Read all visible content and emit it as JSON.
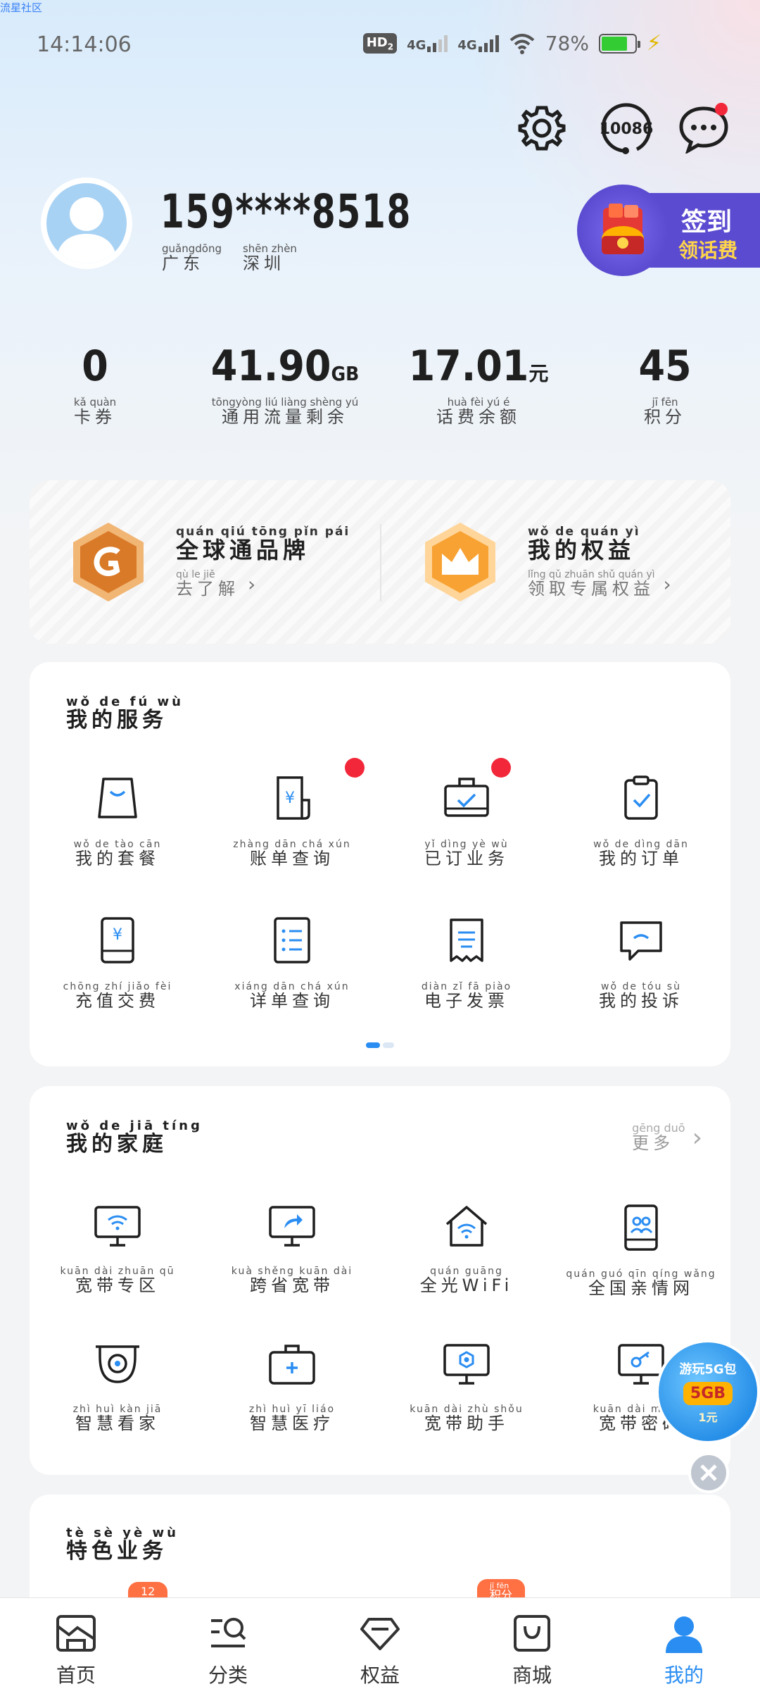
{
  "watermark": "流星社区",
  "status_bar": {
    "time": "14:14:06",
    "hd_label": "HD",
    "hd_sub": "2",
    "sim1": "4G",
    "sim2": "4G",
    "battery_text": "78%",
    "battery_level": 0.78
  },
  "header": {
    "support_number": "10086",
    "phone_number": "159****8518",
    "location": [
      {
        "pinyin": "guǎngdōng",
        "text": "广东"
      },
      {
        "pinyin": "shēn zhèn",
        "text": "深圳"
      }
    ],
    "signin_title": "签到",
    "signin_sub": "领话费"
  },
  "stats": [
    {
      "value": "0",
      "unit": "",
      "pinyin": "kǎ quàn",
      "label": "卡券"
    },
    {
      "value": "41.90",
      "unit": "GB",
      "pinyin": "tōngyòng liú liàng shèng yú",
      "label": "通用流量剩余"
    },
    {
      "value": "17.01",
      "unit": "元",
      "pinyin": "huà fèi yú é",
      "label": "话费余额"
    },
    {
      "value": "45",
      "unit": "",
      "pinyin": "jī fēn",
      "label": "积分"
    }
  ],
  "promo": {
    "left": {
      "title_pinyin": "quán qiú tōng pǐn pái",
      "title": "全球通品牌",
      "sub_pinyin": "qù le jiě",
      "sub": "去了解"
    },
    "right": {
      "title_pinyin": "wǒ de quán yì",
      "title": "我的权益",
      "sub_pinyin": "lǐng qǔ zhuān shǔ quán yì",
      "sub": "领取专属权益"
    }
  },
  "services": {
    "title_pinyin": "wǒ de fú wù",
    "title": "我的服务",
    "items": [
      {
        "pinyin": "wǒ de tào cān",
        "label": "我的套餐",
        "icon": "bag-icon"
      },
      {
        "pinyin": "zhàng dān chá xún",
        "label": "账单查询",
        "icon": "bill-icon"
      },
      {
        "pinyin": "yǐ dìng yè wù",
        "label": "已订业务",
        "icon": "briefcase-check-icon"
      },
      {
        "pinyin": "wǒ de dìng dān",
        "label": "我的订单",
        "icon": "clipboard-check-icon"
      },
      {
        "pinyin": "chōng zhí jiǎo fèi",
        "label": "充值交费",
        "icon": "phone-yuan-icon"
      },
      {
        "pinyin": "xiáng dān chá xún",
        "label": "详单查询",
        "icon": "list-icon"
      },
      {
        "pinyin": "diàn zǐ fā piào",
        "label": "电子发票",
        "icon": "receipt-icon"
      },
      {
        "pinyin": "wǒ de tóu sù",
        "label": "我的投诉",
        "icon": "chat-icon"
      }
    ]
  },
  "family": {
    "title_pinyin": "wǒ de jiā tíng",
    "title": "我的家庭",
    "more_pinyin": "gēng duō",
    "more": "更多",
    "items": [
      {
        "pinyin": "kuān dài zhuān qū",
        "label": "宽带专区",
        "icon": "monitor-wifi-icon"
      },
      {
        "pinyin": "kuà shěng kuān dài",
        "label": "跨省宽带",
        "icon": "monitor-share-icon"
      },
      {
        "pinyin": "quán guāng",
        "label": "全光WiFi",
        "icon": "home-wifi-icon"
      },
      {
        "pinyin": "quán guó qīn qíng wǎng",
        "label": "全国亲情网",
        "icon": "family-icon"
      },
      {
        "pinyin": "zhì huì kàn jiā",
        "label": "智慧看家",
        "icon": "camera-icon"
      },
      {
        "pinyin": "zhì huì yī liáo",
        "label": "智慧医疗",
        "icon": "medical-kit-icon"
      },
      {
        "pinyin": "kuān dài zhù shǒu",
        "label": "宽带助手",
        "icon": "monitor-gear-icon"
      },
      {
        "pinyin": "kuān dài mì mǎ",
        "label": "宽带密码",
        "icon": "monitor-key-icon"
      }
    ]
  },
  "special": {
    "title_pinyin": "tè sè yè wù",
    "title": "特色业务",
    "badge1": "12",
    "badge2_pinyin": "jī fēn",
    "badge2": "积分"
  },
  "float_ad": {
    "line1": "游玩5G包",
    "line2": "5GB",
    "line3": "1元"
  },
  "nav": [
    {
      "label": "首页",
      "icon": "home-photo-icon"
    },
    {
      "label": "分类",
      "icon": "category-search-icon"
    },
    {
      "label": "权益",
      "icon": "diamond-icon"
    },
    {
      "label": "商城",
      "icon": "shopping-bag-icon"
    },
    {
      "label": "我的",
      "icon": "profile-icon"
    }
  ],
  "colors": {
    "accent": "#2a8df2",
    "red_dot": "#f2283a",
    "signin": "#5b4bd1",
    "signin_sub": "#ffd54a"
  }
}
